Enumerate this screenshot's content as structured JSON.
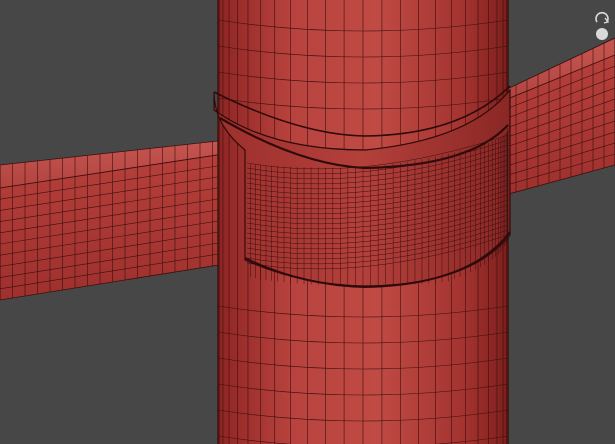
{
  "viewport": {
    "mode": "wireframe-on-shaded",
    "background_color": "#474747",
    "mesh_color": "#a8312f",
    "wire_color": "#3a0f0e"
  },
  "objects": [
    {
      "name": "vertical-cylinder-column"
    },
    {
      "name": "horizontal-rectangular-beam"
    },
    {
      "name": "collar-band"
    }
  ],
  "gizmo": {
    "icon": "view-orbit-icon"
  }
}
